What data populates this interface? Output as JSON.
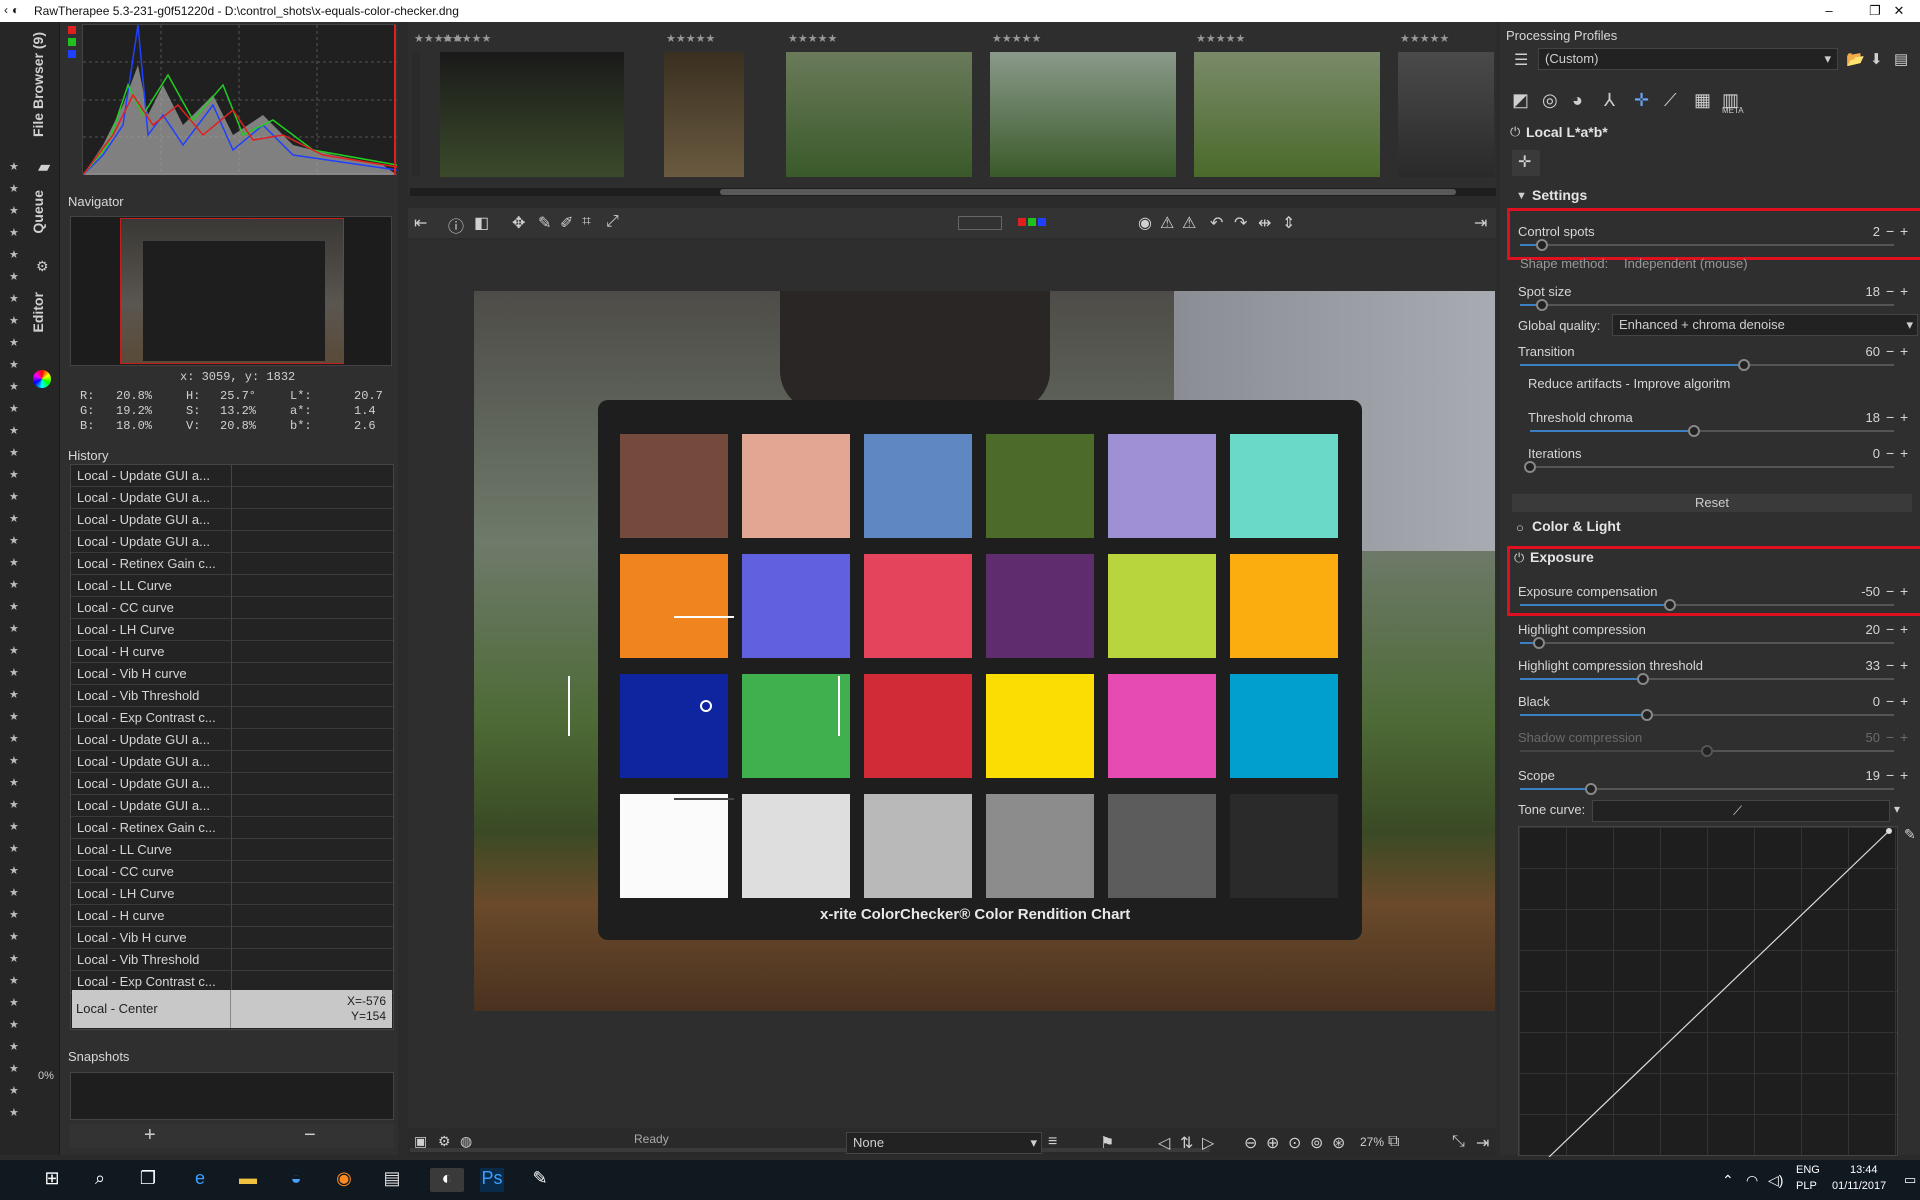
{
  "window": {
    "title": "RawTherapee 5.3-231-g0f51220d - D:\\control_shots\\x-equals-color-checker.dng",
    "minimize": "–",
    "maximize": "❐",
    "close": "✕"
  },
  "vtabs": {
    "file_browser": "File Browser (9)",
    "queue": "Queue",
    "editor": "Editor",
    "progress": "0%"
  },
  "navigator": {
    "title": "Navigator",
    "coords": "x: 3059, y: 1832",
    "r": "20.8%",
    "g": "19.2%",
    "b": "18.0%",
    "h": "25.7°",
    "s": "13.2%",
    "v": "20.8%",
    "l": "20.7",
    "a": "1.4",
    "bb": "2.6"
  },
  "history": {
    "title": "History",
    "items": [
      "Local - Update GUI a...",
      "Local - Update GUI a...",
      "Local - Update GUI a...",
      "Local - Update GUI a...",
      "Local - Retinex Gain c...",
      "Local - LL Curve",
      "Local - CC curve",
      "Local - LH Curve",
      "Local - H curve",
      "Local - Vib H curve",
      "Local - Vib Threshold",
      "Local - Exp Contrast c...",
      "Local - Update GUI a...",
      "Local - Update GUI a...",
      "Local - Update GUI a...",
      "Local - Update GUI a...",
      "Local - Retinex Gain c...",
      "Local - LL Curve",
      "Local - CC curve",
      "Local - LH Curve",
      "Local - H curve",
      "Local - Vib H curve",
      "Local - Vib Threshold",
      "Local - Exp Contrast c..."
    ],
    "selected": {
      "label": "Local - Center",
      "x": "X=-576",
      "y": "Y=154"
    }
  },
  "snapshots": {
    "title": "Snapshots",
    "add": "+",
    "remove": "−"
  },
  "film": {
    "stars": "★★★★★"
  },
  "status": {
    "ready": "Ready",
    "filter": "None",
    "zoom": "27%"
  },
  "chart_caption": "x-rite ColorChecker® Color Rendition Chart",
  "patches": [
    "#744a3c",
    "#e2a793",
    "#5f88c3",
    "#4c6a2a",
    "#9f8fd4",
    "#6bd9c7",
    "#f08520",
    "#6161df",
    "#e4455d",
    "#5f2d6d",
    "#b9d53d",
    "#fbad10",
    "#0e259f",
    "#40b04f",
    "#d22b38",
    "#fbdc03",
    "#e64ab3",
    "#009fcc",
    "#fbfbfb",
    "#dedede",
    "#b9b9b9",
    "#8c8c8c",
    "#5c5c5c",
    "#2a2a2a"
  ],
  "right": {
    "profiles_title": "Processing Profiles",
    "profile_value": "(Custom)",
    "tab_meta": "META",
    "local_lab": "Local L*a*b*",
    "settings": "Settings",
    "control_spots": {
      "label": "Control spots",
      "value": "2"
    },
    "shape_method": {
      "label": "Shape method:",
      "value": "Independent (mouse)"
    },
    "spot_size": {
      "label": "Spot size",
      "value": "18"
    },
    "global_quality": {
      "label": "Global quality:",
      "value": "Enhanced + chroma denoise"
    },
    "transition": {
      "label": "Transition",
      "value": "60"
    },
    "reduce_artifacts": "Reduce artifacts - Improve algoritm",
    "threshold_chroma": {
      "label": "Threshold chroma",
      "value": "18"
    },
    "iterations": {
      "label": "Iterations",
      "value": "0"
    },
    "reset": "Reset",
    "color_light": "Color & Light",
    "exposure": "Exposure",
    "exposure_comp": {
      "label": "Exposure compensation",
      "value": "-50"
    },
    "highlight_comp": {
      "label": "Highlight compression",
      "value": "20"
    },
    "highlight_thr": {
      "label": "Highlight compression threshold",
      "value": "33"
    },
    "black": {
      "label": "Black",
      "value": "0"
    },
    "shadow_comp": {
      "label": "Shadow compression",
      "value": "50"
    },
    "scope": {
      "label": "Scope",
      "value": "19"
    },
    "tone_curve": "Tone curve:"
  },
  "taskbar": {
    "lang1": "ENG",
    "lang2": "PLP",
    "time": "13:44",
    "date": "01/11/2017"
  }
}
